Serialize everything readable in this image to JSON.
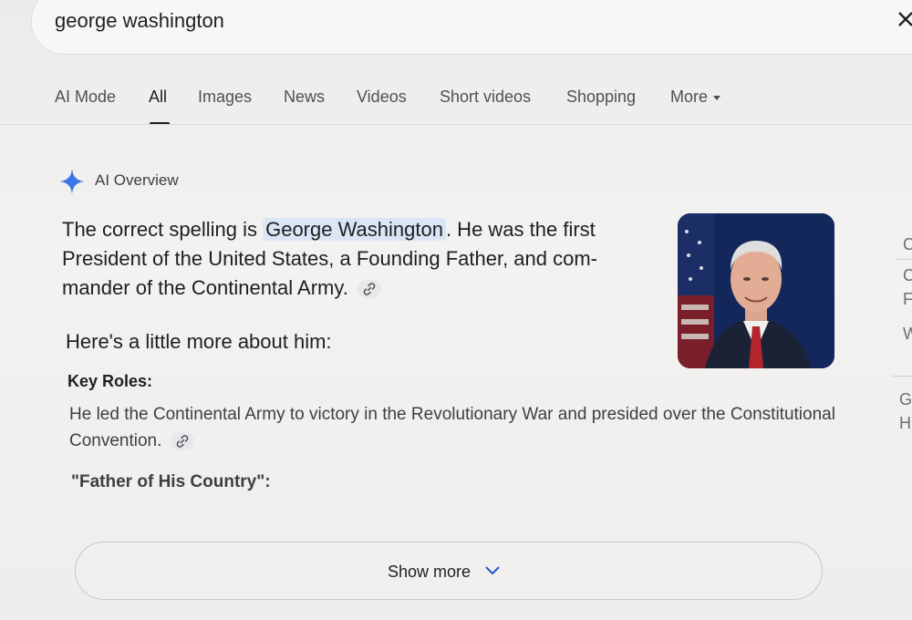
{
  "search": {
    "query": "george washington"
  },
  "tabs": [
    {
      "label": "AI Mode"
    },
    {
      "label": "All"
    },
    {
      "label": "Images"
    },
    {
      "label": "News"
    },
    {
      "label": "Videos"
    },
    {
      "label": "Short videos"
    },
    {
      "label": "Shopping"
    },
    {
      "label": "More"
    }
  ],
  "overview": {
    "label": "AI Overview",
    "lead_prefix": "The correct spelling is ",
    "lead_highlight": "George Washington",
    "lead_suffix": ". He was the first President of the United States, a Founding Father, and com- mander of the Continental Army.",
    "more_about": "Here's a little more about him:",
    "key_roles_heading": "Key Roles:",
    "key_roles_body": "He led the Continental Army to victory in the Revolutionary War and presided over the Constitutional Convention.",
    "father_heading": "\"Father of His Country\":",
    "show_more_label": "Show more"
  },
  "right_column": [
    "C",
    "C",
    "F",
    "W",
    "G",
    "H"
  ],
  "icons": {
    "clear": "close-icon",
    "sparkle": "sparkle-icon",
    "link": "link-icon",
    "chevron": "chevron-down-icon"
  },
  "colors": {
    "highlight": "#dbe5f5",
    "sparkle": "#3b78e7"
  }
}
